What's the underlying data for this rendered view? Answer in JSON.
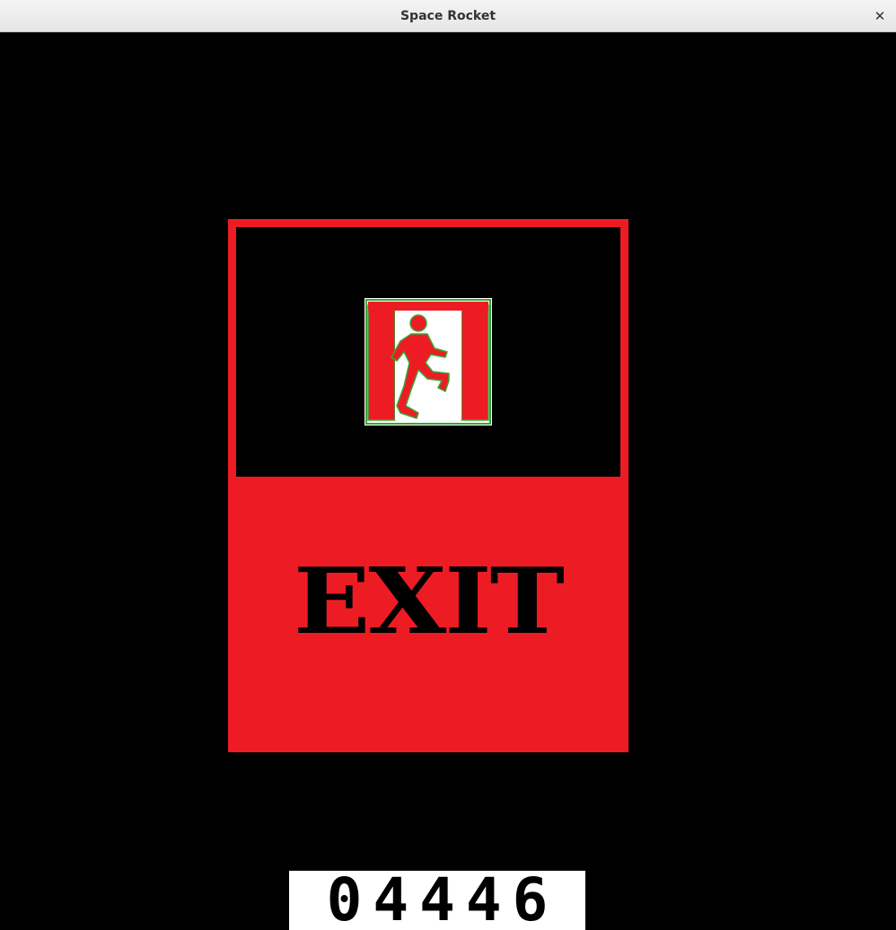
{
  "window": {
    "title": "Space Rocket",
    "close_glyph": "✕"
  },
  "sign": {
    "label": "EXIT",
    "icon": "running-man-exit-icon",
    "frame_color": "#ed1c24",
    "icon_figure_color": "#ed1c24",
    "icon_outline_color": "#3aa537"
  },
  "score": {
    "value": "04446"
  }
}
